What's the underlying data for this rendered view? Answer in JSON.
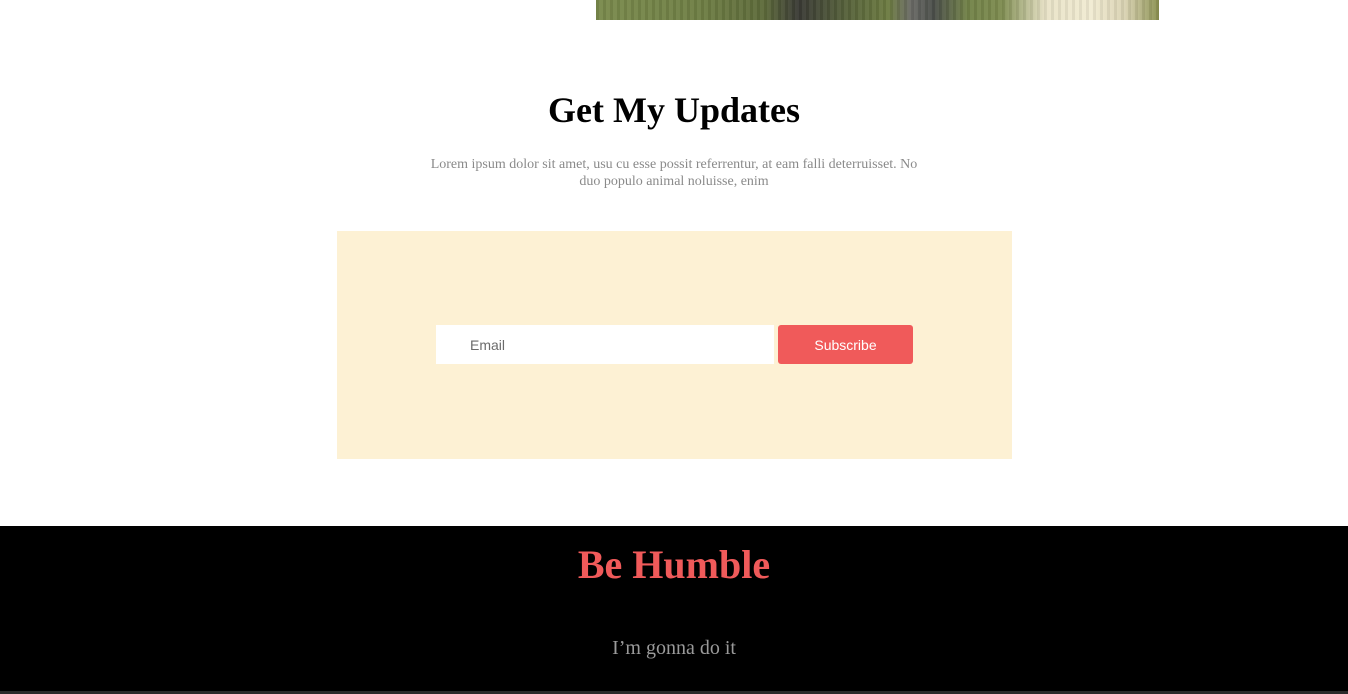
{
  "updates": {
    "title": "Get My Updates",
    "description": "Lorem ipsum dolor sit amet, usu cu esse possit referrentur, at eam falli deterruisset. No duo populo animal noluisse, enim",
    "email_placeholder": "Email",
    "email_value": "",
    "subscribe_label": "Subscribe"
  },
  "footer": {
    "title": "Be Humble",
    "tagline": "I’m gonna do it"
  },
  "colors": {
    "accent": "#f05a5a",
    "panel_background": "#fdf1d4",
    "footer_background": "#000000",
    "muted_text": "#8a8a8a"
  }
}
